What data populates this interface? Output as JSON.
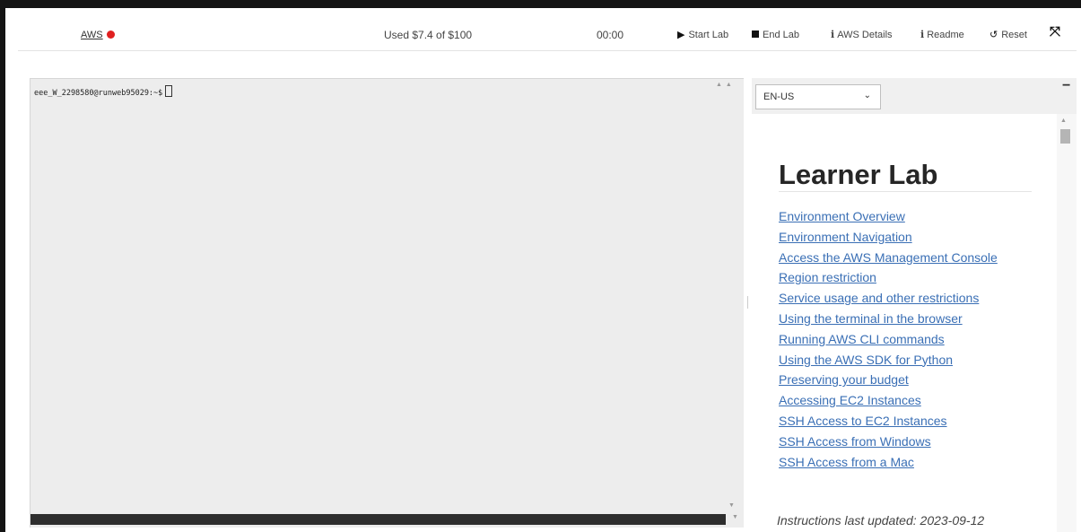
{
  "toolbar": {
    "aws_label": "AWS",
    "status_color": "#e02020",
    "budget_text": "Used $7.4 of $100",
    "timer": "00:00",
    "start_lab": "Start Lab",
    "end_lab": "End Lab",
    "aws_details": "AWS Details",
    "readme": "Readme",
    "reset": "Reset"
  },
  "terminal": {
    "prompt": "eee_W_2298580@runweb95029:~$"
  },
  "panel": {
    "language_selected": "EN-US",
    "title": "Learner Lab",
    "links": [
      "Environment Overview",
      "Environment Navigation",
      "Access the AWS Management Console",
      "Region restriction",
      "Service usage and other restrictions",
      "Using the terminal in the browser",
      "Running AWS CLI commands",
      "Using the AWS SDK for Python",
      "Preserving your budget",
      "Accessing EC2 Instances",
      "SSH Access to EC2 Instances",
      "SSH Access from Windows",
      "SSH Access from a Mac"
    ],
    "updated": "Instructions last updated: 2023-09-12"
  },
  "colors": {
    "link": "#3a6fb5",
    "terminal_bg": "#ededed",
    "panel_bg": "#f0f0f0"
  }
}
